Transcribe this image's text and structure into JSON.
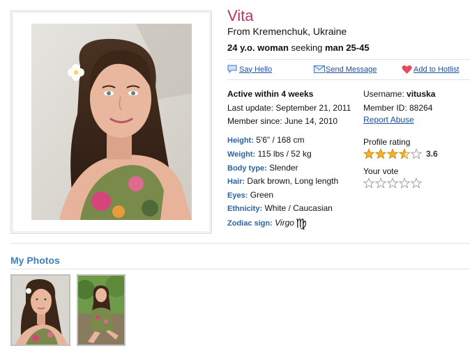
{
  "profile": {
    "name": "Vita",
    "from": "From Kremenchuk, Ukraine",
    "age_text": "24 y.o. woman",
    "seeking_word": "seeking",
    "seeking_text": "man 25-45"
  },
  "actions": {
    "say_hello": "Say Hello",
    "send_message": "Send Message",
    "add_hotlist": "Add to Hotlist"
  },
  "activity": {
    "active": "Active within 4 weeks",
    "last_update": "Last update: September 21, 2011",
    "member_since": "Member since: June 14, 2010"
  },
  "account": {
    "username_label": "Username:",
    "username": "vituska",
    "member_id": "Member ID: 88264",
    "report_abuse": "Report Abuse"
  },
  "details": [
    {
      "label": "Height:",
      "value": "5'6\" / 168 cm"
    },
    {
      "label": "Weight:",
      "value": "115 lbs / 52 kg"
    },
    {
      "label": "Body type:",
      "value": "Slender"
    },
    {
      "label": "Hair:",
      "value": "Dark brown, Long length"
    },
    {
      "label": "Eyes:",
      "value": "Green"
    },
    {
      "label": "Ethnicity:",
      "value": "White / Caucasian"
    },
    {
      "label": "Zodiac sign:",
      "value": "Virgo"
    }
  ],
  "zodiac_symbol": "♍",
  "rating": {
    "label": "Profile rating",
    "value": "3.6",
    "stars_filled": 3.6,
    "vote_label": "Your vote",
    "vote_stars": 0
  },
  "photos": {
    "title": "My Photos",
    "count": 2
  },
  "colors": {
    "name": "#b8336a",
    "link": "#1a4fa3",
    "label": "#2a63a6",
    "section": "#3f7fb5",
    "star": "#f3b32a"
  }
}
